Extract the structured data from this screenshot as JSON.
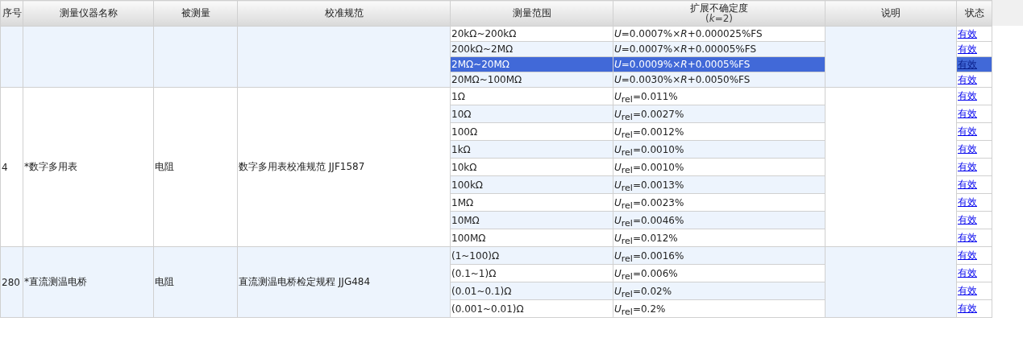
{
  "columns": [
    "序号",
    "测量仪器名称",
    "被测量",
    "校准规范",
    "测量范围",
    "扩展不确定度",
    "说明",
    "状态"
  ],
  "uncertainty_note": "(*k*=2)",
  "groups": [
    {
      "rows": [
        {
          "range": "20kΩ~200kΩ",
          "uncertainty": "*U*=0.0007%×*R*+0.000025%FS",
          "status": "有效",
          "selected": false
        },
        {
          "range": "200kΩ~2MΩ",
          "uncertainty": "*U*=0.0007%×*R*+0.00005%FS",
          "status": "有效",
          "selected": false
        },
        {
          "range": "2MΩ~20MΩ",
          "uncertainty": "*U*=0.0009%×*R*+0.0005%FS",
          "status": "有效",
          "selected": true
        },
        {
          "range": "20MΩ~100MΩ",
          "uncertainty": "*U*=0.0030%×*R*+0.0050%FS",
          "status": "有效",
          "selected": false
        }
      ]
    },
    {
      "number": "4",
      "instrument": "*数字多用表",
      "quantity": "电阻",
      "standard": "数字多用表校准规范 JJF1587",
      "rows": [
        {
          "range": "1Ω",
          "uncertainty": "*U*$_{rel}$=0.011%",
          "status": "有效",
          "selected": false
        },
        {
          "range": "10Ω",
          "uncertainty": "*U*$_{rel}$=0.0027%",
          "status": "有效",
          "selected": false
        },
        {
          "range": "100Ω",
          "uncertainty": "*U*$_{rel}$=0.0012%",
          "status": "有效",
          "selected": false
        },
        {
          "range": "1kΩ",
          "uncertainty": "*U*$_{rel}$=0.0010%",
          "status": "有效",
          "selected": false
        },
        {
          "range": "10kΩ",
          "uncertainty": "*U*$_{rel}$=0.0010%",
          "status": "有效",
          "selected": false
        },
        {
          "range": "100kΩ",
          "uncertainty": "*U*$_{rel}$=0.0013%",
          "status": "有效",
          "selected": false
        },
        {
          "range": "1MΩ",
          "uncertainty": "*U*$_{rel}$=0.0023%",
          "status": "有效",
          "selected": false
        },
        {
          "range": "10MΩ",
          "uncertainty": "*U*$_{rel}$=0.0046%",
          "status": "有效",
          "selected": false
        },
        {
          "range": "100MΩ",
          "uncertainty": "*U*$_{rel}$=0.012%",
          "status": "有效",
          "selected": false
        }
      ]
    },
    {
      "number": "280",
      "instrument": "*直流测温电桥",
      "quantity": "电阻",
      "standard": "直流测温电桥检定规程 JJG484",
      "rows": [
        {
          "range": "(1~100)Ω",
          "uncertainty": "*U*$_{rel}$=0.0016%",
          "status": "有效",
          "selected": false
        },
        {
          "range": "(0.1~1)Ω",
          "uncertainty": "*U*$_{rel}$=0.006%",
          "status": "有效",
          "selected": false
        },
        {
          "range": "(0.01~0.1)Ω",
          "uncertainty": "*U*$_{rel}$=0.02%",
          "status": "有效",
          "selected": false
        },
        {
          "range": "(0.001~0.01)Ω",
          "uncertainty": "*U*$_{rel}$=0.2%",
          "status": "有效",
          "selected": false
        }
      ]
    }
  ]
}
